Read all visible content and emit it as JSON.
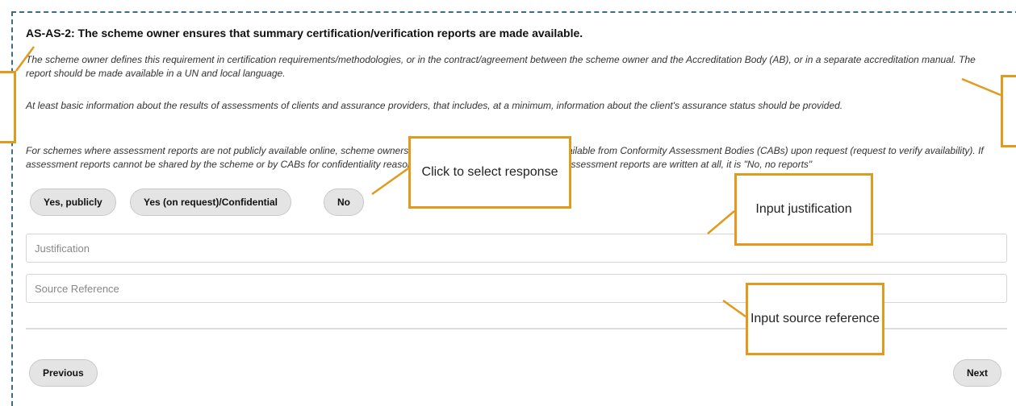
{
  "requirement": {
    "title": "AS-AS-2: The scheme owner ensures that summary certification/verification reports are made available.",
    "paragraphs": [
      "The scheme owner defines this requirement in certification requirements/methodologies, or in the contract/agreement between the scheme owner and the Accreditation Body (AB), or in a separate accreditation manual. The report should be made available in a UN and local language.",
      "At least basic information about the results of assessments of clients and assurance providers, that includes, at a minimum, information about the client's assurance status should be provided.",
      "For schemes where assessment reports are not publicly available online, scheme owners should check whether reports are available from Conformity Assessment Bodies (CABs) upon request (request to verify availability). If assessment reports cannot be shared by the scheme or by CABs for confidentiality reasons, the answer is \"confidential\". If no assessment reports are written at all, it is \"No, no reports\""
    ]
  },
  "responses": {
    "yes_public": "Yes, publicly",
    "yes_request": "Yes (on request)/Confidential",
    "no": "No"
  },
  "fields": {
    "justification_placeholder": "Justification",
    "source_placeholder": "Source Reference"
  },
  "nav": {
    "previous": "Previous",
    "next": "Next"
  },
  "callouts": {
    "select": "Click to select response",
    "justification": "Input justification",
    "source": "Input source reference"
  },
  "colors": {
    "callout_border": "#e29a1d",
    "frame_dash": "#3c6e80"
  }
}
